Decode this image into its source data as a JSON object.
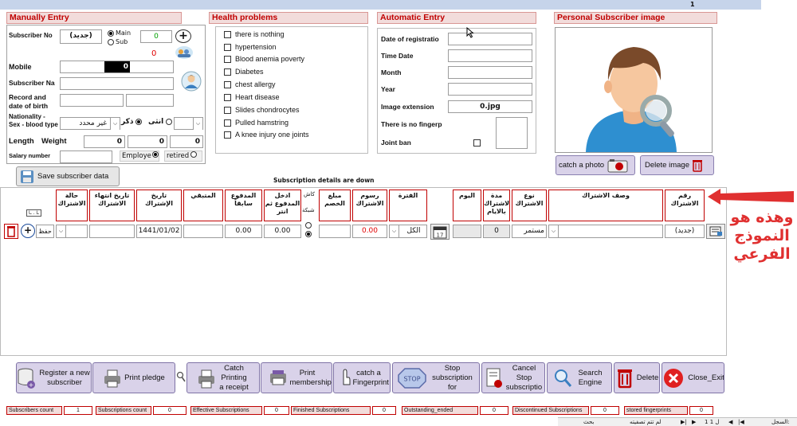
{
  "top": {
    "record_num": "1"
  },
  "manual": {
    "title": "Manually Entry",
    "subscriber_no_label": "Subscriber  No",
    "subscriber_no_value": "(جديد)",
    "main_label": "Main",
    "sub_label": "Sub",
    "count_green": "0",
    "count_red": "0",
    "mobile_label": "Mobile",
    "mobile_value": "0",
    "name_label": "Subscriber  Na",
    "dob_label": "Record and date of birth",
    "nat_label": "Nationality - Sex - blood type",
    "nat_value": "غير محدد",
    "male_label": "ذكر",
    "female_label": "انثى",
    "length_label": "Length",
    "weight_label": "Weight",
    "length_value": "0",
    "weight_value": "0",
    "third_value": "0",
    "salary_label": "Salary number",
    "employee_label": "Employe",
    "retired_label": "retired",
    "save_label": "Save subscriber data"
  },
  "health": {
    "title": "Health problems",
    "items": [
      "there is nothing",
      "hypertension",
      "Blood anemia poverty",
      "Diabetes",
      "chest allergy",
      "Heart disease",
      "Slides chondrocytes",
      "Pulled hamstring",
      "A knee injury one joints"
    ]
  },
  "auto": {
    "title": "Automatic Entry",
    "reg_label": "Date of registratio",
    "time_label": "Time Date",
    "month_label": "Month",
    "year_label": "Year",
    "ext_label": "Image extension",
    "ext_value": "0.jpg",
    "finger_label": "There is no fingerp",
    "ban_label": "Joint ban"
  },
  "photo": {
    "title": "Personal Subscriber  image",
    "catch_label": "catch a photo",
    "delete_label": "Delete image"
  },
  "subs": {
    "title": "Subscription details are down",
    "headers": {
      "state": "حالة الاشتراك",
      "end_date": "تاريخ انتهاء الاشتراك",
      "sub_date": "تاريخ الإشتراك",
      "remaining": "المتبقي",
      "paid_before": "المدفوع سابقاً",
      "enter_paid": "ادخل المدفوع ثم انتر",
      "cash": "كاش",
      "network": "شبكة",
      "discount": "مبلغ الخصم",
      "fees": "رسوم الاشتراك",
      "period": "الفترة",
      "day": "اليوم",
      "duration": "مدة الاشتراك بالايام",
      "type": "نوع الاشتراك",
      "desc": "وصف الاشتراك",
      "number": "رقم الاشتراك"
    },
    "row": {
      "save": "حفظ",
      "sub_date": "1441/01/02",
      "paid_before": "0.00",
      "enter_paid": "0.00",
      "fees": "0.00",
      "period": "الكل",
      "duration": "0",
      "type": "مستمر",
      "number": "(جديد)"
    },
    "annotation": "وهذه هو النموذج الفرعي"
  },
  "buttons": {
    "register": "Register a new subscriber",
    "print_pledge": "Print pledge",
    "catch_print": "Catch Printing a receipt",
    "print_membership": "Print membership",
    "catch_finger": "catch a Fingerprint",
    "stop": "Stop subscription for",
    "cancel_stop": "Cancel Stop subscriptio",
    "search": "Search Engine",
    "delete": "Delete",
    "close": "Close_Exit",
    "stop_icon_text": "STOP"
  },
  "stats": [
    {
      "label": "Subscribers count",
      "value": "1"
    },
    {
      "label": "Subscriptions count",
      "value": "0"
    },
    {
      "label": "Effective Subscriptions",
      "value": "0"
    },
    {
      "label": "Finished Subscriptions",
      "value": "0"
    },
    {
      "label": "Outstanding_ended",
      "value": "0"
    },
    {
      "label": "Discontinued Subscriptions",
      "value": "0"
    },
    {
      "label": "stored fingerprints",
      "value": "0"
    }
  ],
  "nav": {
    "record_label": "السجل:",
    "record_pos": "1 ل 1",
    "filter": "لم تتم تصفيته",
    "search": "بحث"
  },
  "colors": {
    "section_red": "#c00000",
    "section_fill": "#f2dcdb",
    "button_purple": "#d9d2e9",
    "top_blue": "#c6d4ea"
  }
}
